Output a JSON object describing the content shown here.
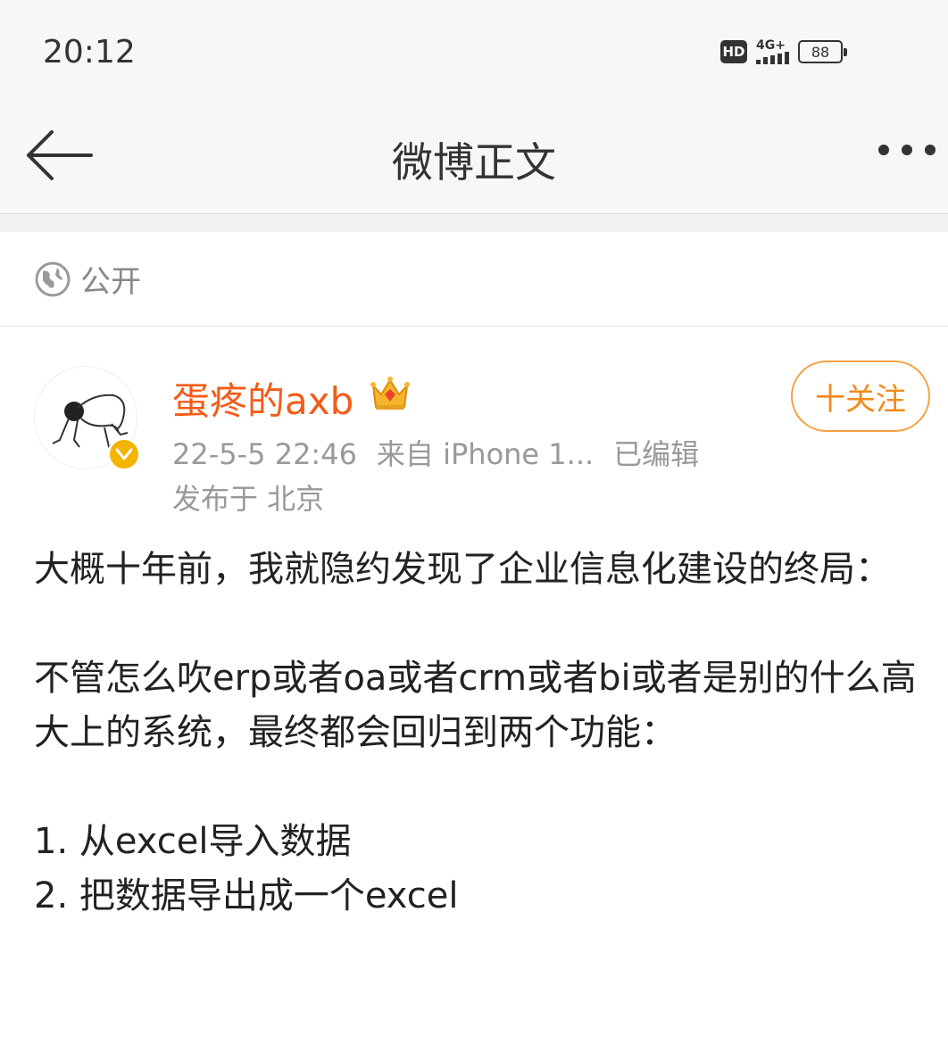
{
  "status_bar": {
    "time": "20:12",
    "hd": "HD",
    "network": "4G+",
    "battery": "88"
  },
  "nav": {
    "title": "微博正文",
    "back_icon": "arrow-left-icon",
    "more_icon": "more-dots-icon"
  },
  "visibility": {
    "icon": "globe-icon",
    "label": "公开"
  },
  "post": {
    "author": "蛋疼的axb",
    "follow_label": "十关注",
    "date": "22-5-5 22:46",
    "source": "来自 iPhone 1...",
    "edited": "已编辑",
    "location": "发布于 北京",
    "paragraphs": [
      "大概十年前，我就隐约发现了企业信息化建设的终局：",
      "不管怎么吹erp或者oa或者crm或者bi或者是别的什么高大上的系统，最终都会回归到两个功能：",
      "1. 从excel导入数据",
      "2. 把数据导出成一个excel"
    ]
  },
  "colors": {
    "accent": "#f25c19",
    "follow": "#f28a1a",
    "meta": "#999999",
    "verified": "#f5b400"
  }
}
